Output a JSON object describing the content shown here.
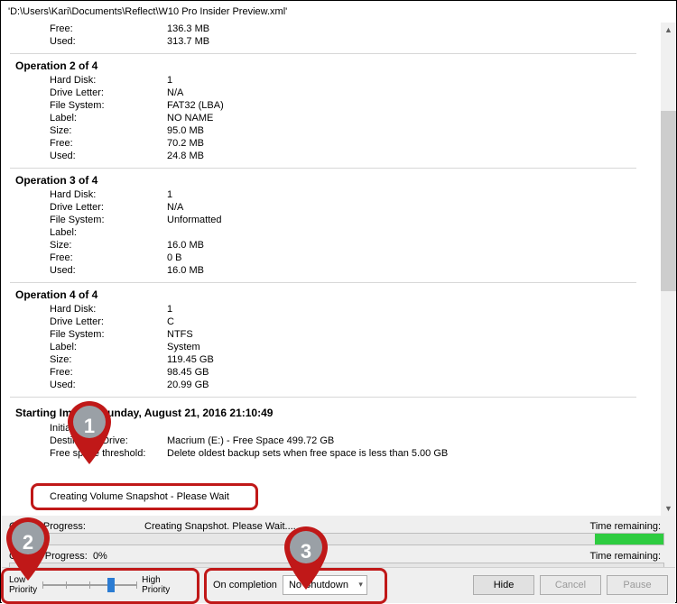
{
  "title": "'D:\\Users\\Kari\\Documents\\Reflect\\W10 Pro Insider Preview.xml'",
  "pre_rows": [
    {
      "label": "Free:",
      "value": "136.3 MB"
    },
    {
      "label": "Used:",
      "value": "313.7 MB"
    }
  ],
  "operations": [
    {
      "header": "Operation 2 of 4",
      "rows": [
        {
          "label": "Hard Disk:",
          "value": "1"
        },
        {
          "label": "Drive Letter:",
          "value": "N/A"
        },
        {
          "label": "File System:",
          "value": "FAT32 (LBA)"
        },
        {
          "label": "Label:",
          "value": "NO NAME"
        },
        {
          "label": "Size:",
          "value": "95.0 MB"
        },
        {
          "label": "Free:",
          "value": "70.2 MB"
        },
        {
          "label": "Used:",
          "value": "24.8 MB"
        }
      ]
    },
    {
      "header": "Operation 3 of 4",
      "rows": [
        {
          "label": "Hard Disk:",
          "value": "1"
        },
        {
          "label": "Drive Letter:",
          "value": "N/A"
        },
        {
          "label": "File System:",
          "value": "Unformatted"
        },
        {
          "label": "Label:",
          "value": ""
        },
        {
          "label": "Size:",
          "value": "16.0 MB"
        },
        {
          "label": "Free:",
          "value": "0 B"
        },
        {
          "label": "Used:",
          "value": "16.0 MB"
        }
      ]
    },
    {
      "header": "Operation 4 of 4",
      "rows": [
        {
          "label": "Hard Disk:",
          "value": "1"
        },
        {
          "label": "Drive Letter:",
          "value": "C"
        },
        {
          "label": "File System:",
          "value": "NTFS"
        },
        {
          "label": "Label:",
          "value": "System"
        },
        {
          "label": "Size:",
          "value": "119.45 GB"
        },
        {
          "label": "Free:",
          "value": "98.45 GB"
        },
        {
          "label": "Used:",
          "value": "20.99 GB"
        }
      ]
    }
  ],
  "starting": {
    "header": "Starting Image - Sunday, August 21, 2016 21:10:49",
    "init": "Initializing",
    "rows": [
      {
        "label": "Destination Drive:",
        "value": "Macrium (E:) - Free Space 499.72 GB"
      },
      {
        "label": "Free space threshold:",
        "value": "Delete oldest backup sets when free space is less than 5.00 GB"
      }
    ]
  },
  "snapshot": "Creating Volume Snapshot - Please Wait",
  "progress": {
    "overall_label": "Overall Progress:",
    "overall_status": "Creating Snapshot. Please Wait....",
    "current_label": "Current Progress:",
    "current_value": "0%",
    "time_remaining_label": "Time remaining:"
  },
  "priority": {
    "low": "Low\nPriority",
    "high": "High\nPriority"
  },
  "completion": {
    "label": "On completion",
    "selected": "No Shutdown"
  },
  "buttons": {
    "hide": "Hide",
    "cancel": "Cancel",
    "pause": "Pause"
  },
  "markers": {
    "m1": "1",
    "m2": "2",
    "m3": "3"
  }
}
